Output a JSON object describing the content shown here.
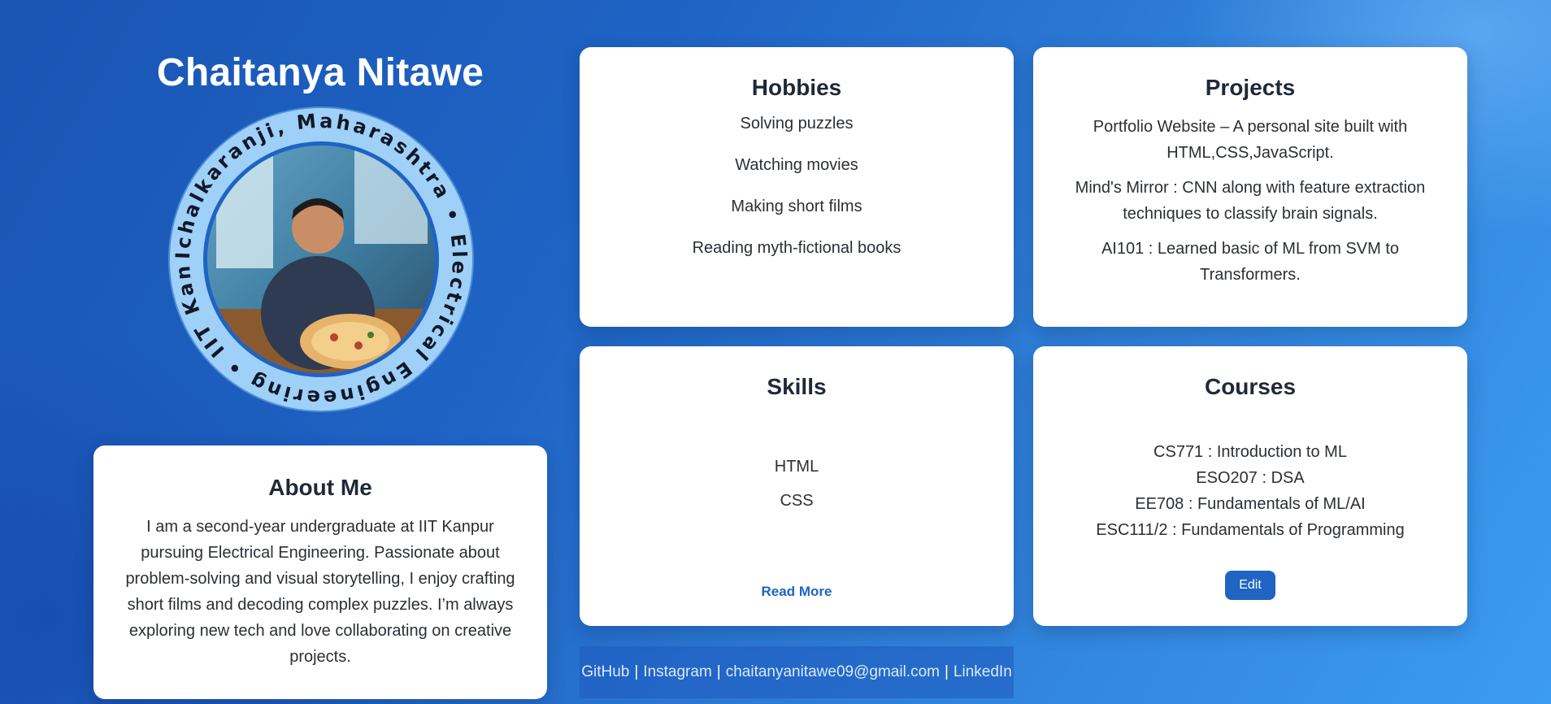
{
  "profile": {
    "name": "Chaitanya Nitawe",
    "badge_ring_text": "Ichalkaranji, Maharashtra • Electrical Engineering • IIT Kanpur •"
  },
  "about": {
    "title": "About Me",
    "text": "I am a second-year undergraduate at IIT Kanpur pursuing Electrical Engineering. Passionate about problem-solving and visual storytelling, I enjoy crafting short films and decoding complex puzzles. I’m always exploring new tech and love collaborating on creative projects."
  },
  "hobbies": {
    "title": "Hobbies",
    "items": [
      "Solving puzzles",
      "Watching movies",
      "Making short films",
      "Reading myth-fictional books"
    ]
  },
  "projects": {
    "title": "Projects",
    "items": [
      "Portfolio Website – A personal site built with HTML,CSS,JavaScript.",
      "Mind's Mirror : CNN along with feature extraction techniques to classify brain signals.",
      "AI101 : Learned basic of ML from SVM to Transformers."
    ]
  },
  "skills": {
    "title": "Skills",
    "items": [
      "HTML",
      "CSS"
    ],
    "read_more_label": "Read More"
  },
  "courses": {
    "title": "Courses",
    "items": [
      "CS771 : Introduction to ML",
      "ESO207 : DSA",
      "EE708 : Fundamentals of ML/AI",
      "ESC111/2 : Fundamentals of Programming"
    ],
    "edit_label": "Edit"
  },
  "footer": {
    "links": [
      "GitHub",
      "Instagram",
      "chaitanyanitawe09@gmail.com",
      "LinkedIn"
    ],
    "separator": "|"
  },
  "colors": {
    "accent": "#1f64c1",
    "badge_ring": "#9fd0f8",
    "badge_border": "#1e63c4"
  }
}
